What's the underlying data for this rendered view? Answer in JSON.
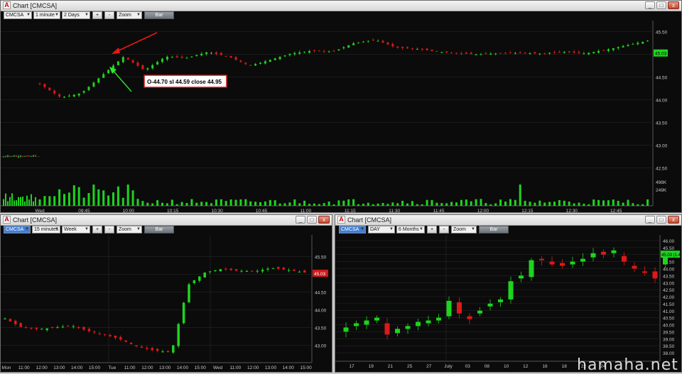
{
  "colors": {
    "up": "#1ed41e",
    "down": "#e01818",
    "bg": "#0b0b0b",
    "grid": "#2a2a2a",
    "axis_text": "#c8c8c8",
    "volume": "#1ed41e"
  },
  "top": {
    "title": "Chart [CMCSA]",
    "symbol": "CMCSA",
    "interval": "1 minute",
    "range": "2 Days",
    "plus": "+",
    "minus": "-",
    "zoom": "Zoom",
    "bar_button": "Bar",
    "price_ticks": [
      "45.50",
      "45.00",
      "44.50",
      "44.00",
      "43.50",
      "43.00",
      "42.50"
    ],
    "price_tick_values": [
      45.5,
      45.0,
      44.5,
      44.0,
      43.5,
      43.0,
      42.5
    ],
    "last_price": "45.03",
    "volume_ticks": [
      "498K",
      "249K"
    ],
    "time_ticks": [
      "Wed",
      "09:45",
      "10:00",
      "10:15",
      "10:30",
      "10:45",
      "11:00",
      "11:15",
      "11:30",
      "11:45",
      "12:00",
      "12:15",
      "12:30",
      "12:45"
    ],
    "annotation": "O-44.70 sl 44.59 close 44.95"
  },
  "bottom_left": {
    "title": "Chart [CMCSA]",
    "symbol": "CMCSA",
    "interval": "15 minutes",
    "range": "Week",
    "plus": "+",
    "minus": "-",
    "zoom": "Zoom",
    "bar_button": "Bar",
    "price_ticks": [
      "45.50",
      "45.00",
      "44.50",
      "44.00",
      "43.50",
      "43.00"
    ],
    "price_tick_values": [
      45.5,
      45.0,
      44.5,
      44.0,
      43.5,
      43.0
    ],
    "last_price": "45.03",
    "time_ticks": [
      "Mon",
      "11:00",
      "12:00",
      "13:00",
      "14:00",
      "15:00",
      "Tue",
      "11:00",
      "12:00",
      "13:00",
      "14:00",
      "15:00",
      "Wed",
      "11:00",
      "12:00",
      "13:00",
      "14:00",
      "15:00"
    ]
  },
  "bottom_right": {
    "title": "Chart [CMCSA]",
    "symbol": "CMCSA",
    "interval": "DAY",
    "range": "6 Months",
    "plus": "+",
    "minus": "-",
    "zoom": "Zoom",
    "bar_button": "Bar",
    "price_ticks": [
      "46.00",
      "45.50",
      "45.00",
      "44.50",
      "44.00",
      "43.50",
      "43.00",
      "42.50",
      "42.00",
      "41.50",
      "41.00",
      "40.50",
      "40.00",
      "39.50",
      "39.00",
      "38.50",
      "38.00"
    ],
    "price_tick_values": [
      46,
      45.5,
      45,
      44.5,
      44,
      43.5,
      43,
      42.5,
      42,
      41.5,
      41,
      40.5,
      40,
      39.5,
      39,
      38.5,
      38
    ],
    "last_price": "45.03 (1.4)",
    "time_ticks": [
      "17",
      "19",
      "21",
      "25",
      "27",
      "July",
      "03",
      "08",
      "10",
      "12",
      "16",
      "18",
      "22",
      "24"
    ]
  },
  "watermark": "hamaha.net"
}
